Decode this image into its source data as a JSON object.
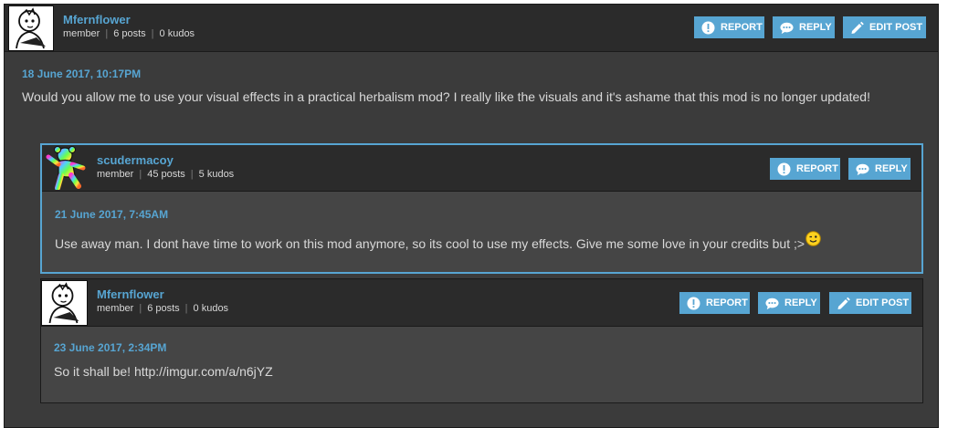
{
  "main_post": {
    "username": "Mfernflower",
    "role": "member",
    "posts": "6 posts",
    "kudos": "0 kudos",
    "date": "18 June 2017, 10:17PM",
    "text": "Would you allow me to use your visual effects in a practical herbalism mod? I really like the visuals and it's ashame that this mod is no longer updated!",
    "buttons": {
      "report": "REPORT",
      "reply": "REPLY",
      "edit": "EDIT POST"
    }
  },
  "reply1": {
    "username": "scudermacoy",
    "role": "member",
    "posts": "45 posts",
    "kudos": "5 kudos",
    "date": "21 June 2017, 7:45AM",
    "text": "Use away man. I dont have time to work on this mod anymore, so its cool to use my effects. Give me some love in your credits but ;>",
    "buttons": {
      "report": "REPORT",
      "reply": "REPLY"
    }
  },
  "reply2": {
    "username": "Mfernflower",
    "role": "member",
    "posts": "6 posts",
    "kudos": "0 kudos",
    "date": "23 June 2017, 2:34PM",
    "text_prefix": "So it shall be! ",
    "link": "http://imgur.com/a/n6jYZ",
    "buttons": {
      "report": "REPORT",
      "reply": "REPLY",
      "edit": "EDIT POST"
    }
  },
  "colors": {
    "accent": "#57a5d2",
    "header": "#2b2b2b",
    "body": "#3b3b3b",
    "reply_body": "#454545"
  },
  "icons": [
    "report-icon",
    "reply-icon",
    "edit-icon",
    "wink-emoji-icon",
    "avatar-sketch",
    "avatar-dancing-bear"
  ]
}
